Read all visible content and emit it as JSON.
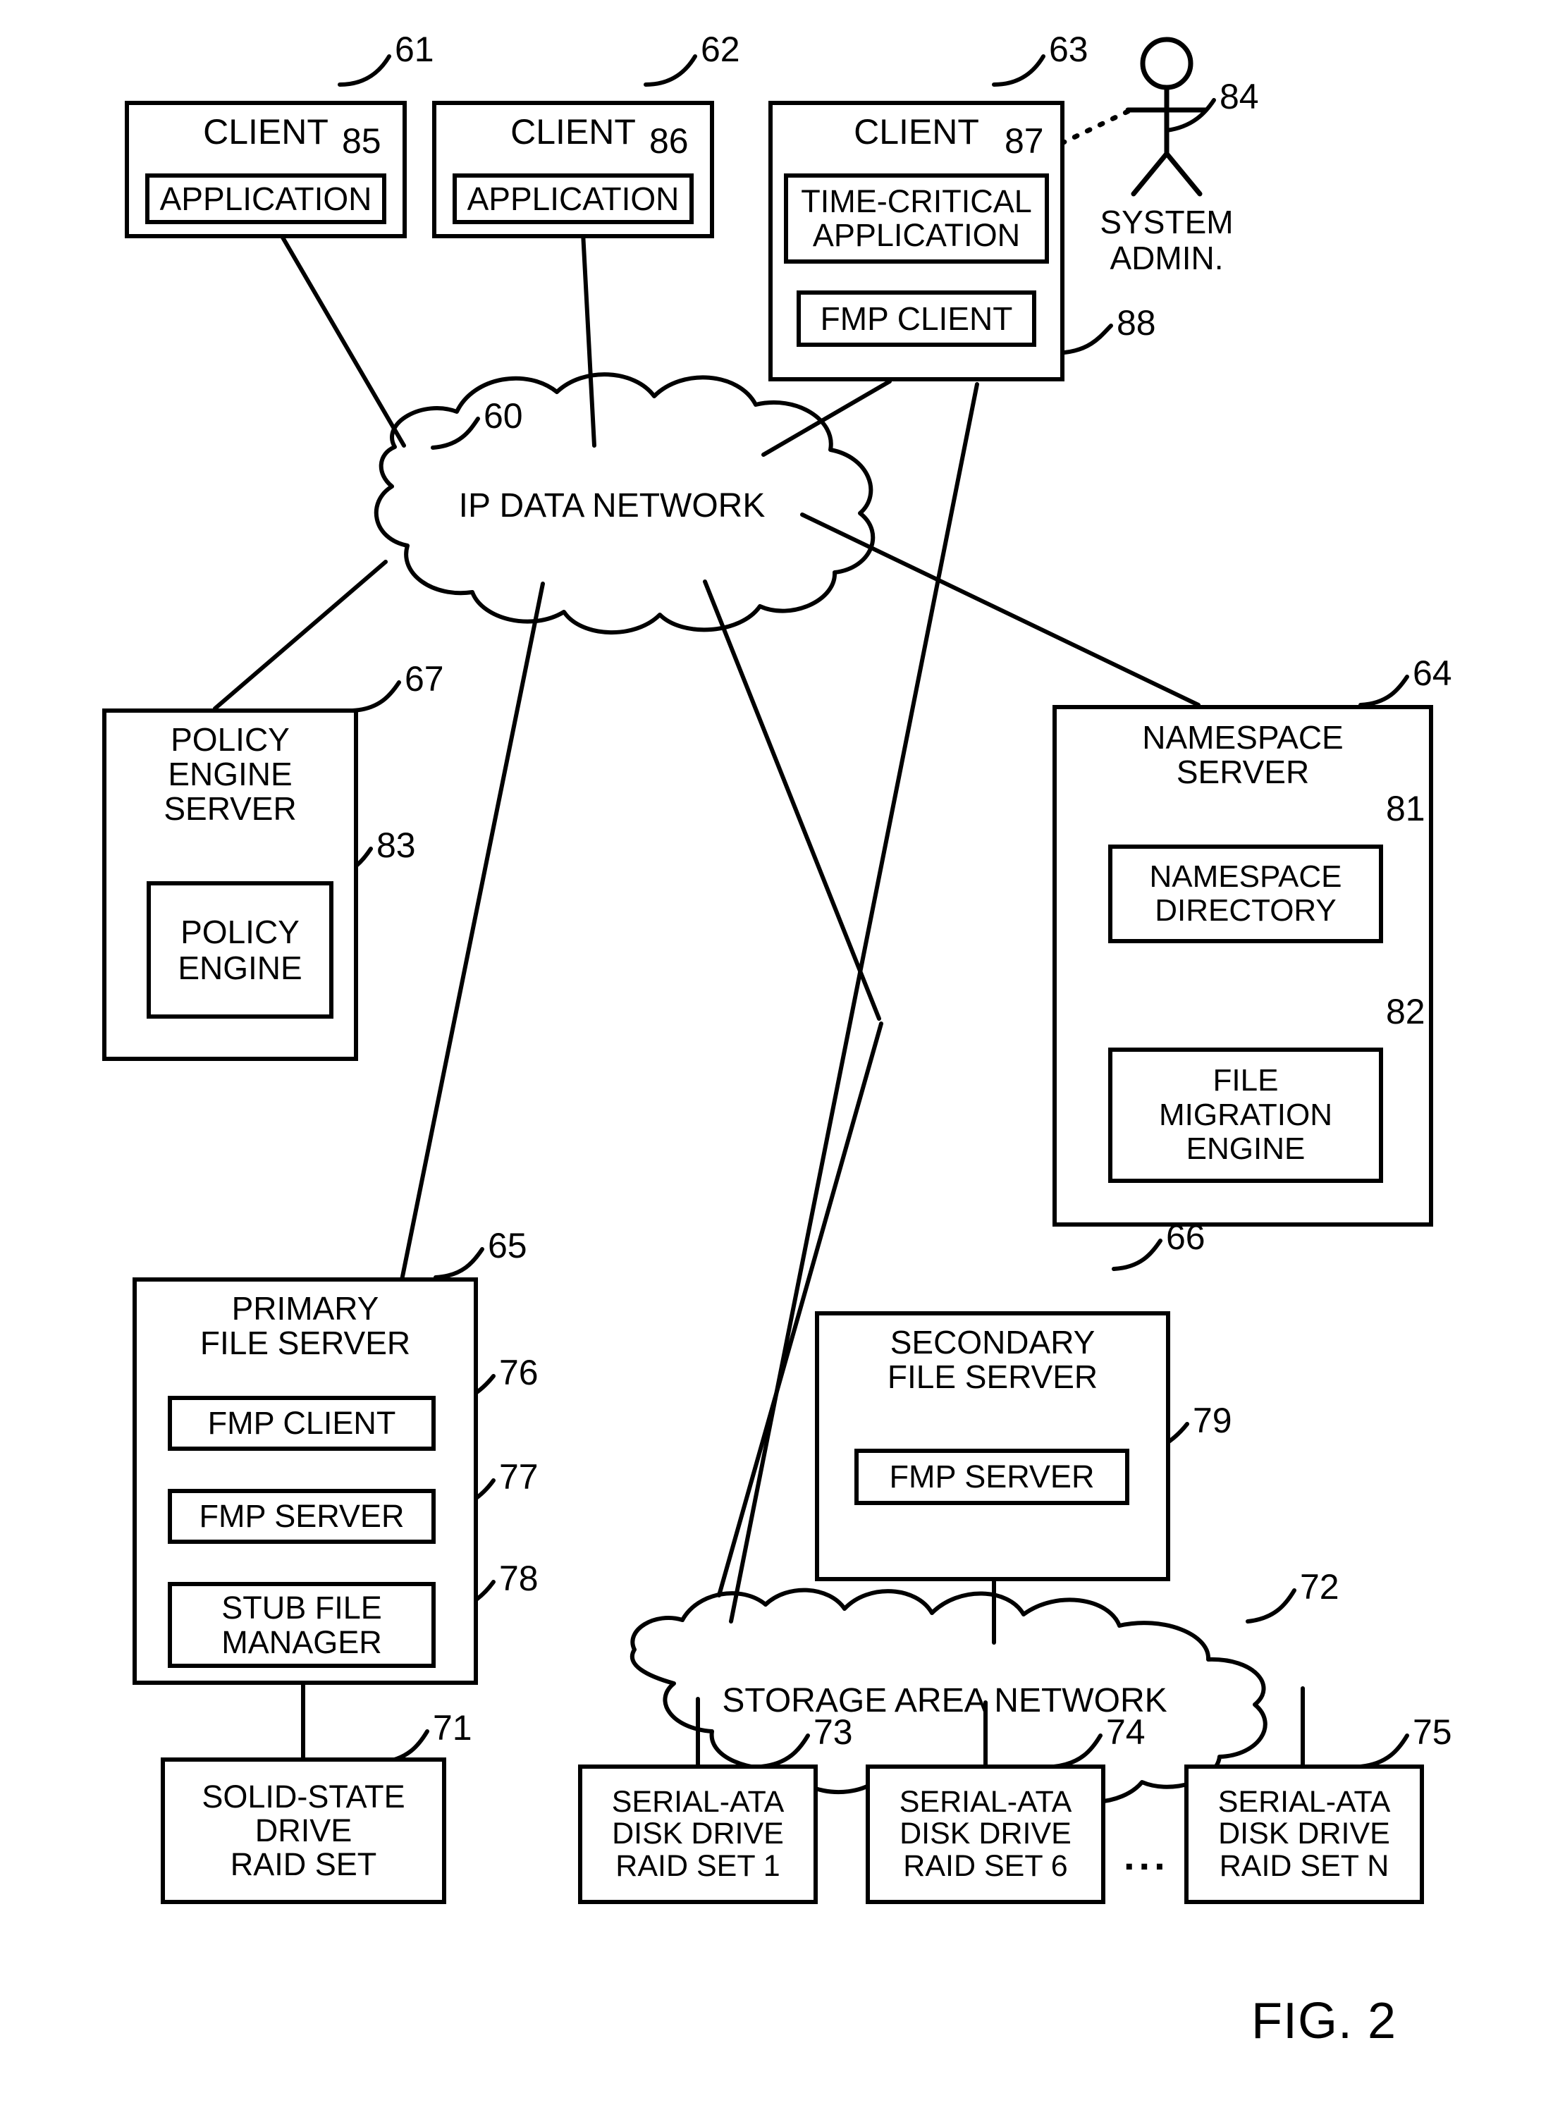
{
  "figure": {
    "label": "FIG. 2",
    "ellipsis": "..."
  },
  "networks": [
    {
      "id": "ip-data-network",
      "label": "IP DATA NETWORK",
      "ref": "60"
    },
    {
      "id": "storage-area-network",
      "label": "STORAGE AREA NETWORK",
      "ref": "72"
    }
  ],
  "actor": {
    "label": "SYSTEM\nADMIN.",
    "ref": "84"
  },
  "nodes": [
    {
      "id": "client-61",
      "title": "CLIENT",
      "ref": "61",
      "inner": {
        "title": "APPLICATION",
        "ref": "85"
      }
    },
    {
      "id": "client-62",
      "title": "CLIENT",
      "ref": "62",
      "inner": {
        "title": "APPLICATION",
        "ref": "86"
      }
    },
    {
      "id": "client-63",
      "title": "CLIENT",
      "ref": "63",
      "inner_a": {
        "title": "TIME-CRITICAL\nAPPLICATION",
        "ref": "87"
      },
      "inner_b": {
        "title": "FMP CLIENT",
        "ref": "88"
      }
    },
    {
      "id": "policy-engine-server-67",
      "title": "POLICY ENGINE\nSERVER",
      "ref": "67",
      "inner": {
        "title": "POLICY\nENGINE",
        "ref": "83"
      }
    },
    {
      "id": "namespace-server-64",
      "title": "NAMESPACE\nSERVER",
      "ref": "64",
      "inner_a": {
        "title": "NAMESPACE\nDIRECTORY",
        "ref": "81"
      },
      "inner_b": {
        "title": "FILE\nMIGRATION\nENGINE",
        "ref": "82"
      }
    },
    {
      "id": "primary-file-server-65",
      "title": "PRIMARY\nFILE SERVER",
      "ref": "65",
      "inner_a": {
        "title": "FMP CLIENT",
        "ref": "76"
      },
      "inner_b": {
        "title": "FMP SERVER",
        "ref": "77"
      },
      "inner_c": {
        "title": "STUB FILE\nMANAGER",
        "ref": "78"
      }
    },
    {
      "id": "secondary-file-server-66",
      "title": "SECONDARY\nFILE SERVER",
      "ref": "66",
      "inner": {
        "title": "FMP SERVER",
        "ref": "79"
      }
    },
    {
      "id": "solid-state-drive-raid-set-71",
      "title": "SOLID-STATE\nDRIVE\nRAID SET",
      "ref": "71"
    },
    {
      "id": "sata-raid-set-1-73",
      "title": "SERIAL-ATA\nDISK DRIVE\nRAID SET 1",
      "ref": "73"
    },
    {
      "id": "sata-raid-set-6-74",
      "title": "SERIAL-ATA\nDISK DRIVE\nRAID SET 6",
      "ref": "74"
    },
    {
      "id": "sata-raid-set-n-75",
      "title": "SERIAL-ATA\nDISK DRIVE\nRAID SET N",
      "ref": "75"
    }
  ],
  "colors": {
    "line": "#000000",
    "background": "#ffffff"
  }
}
